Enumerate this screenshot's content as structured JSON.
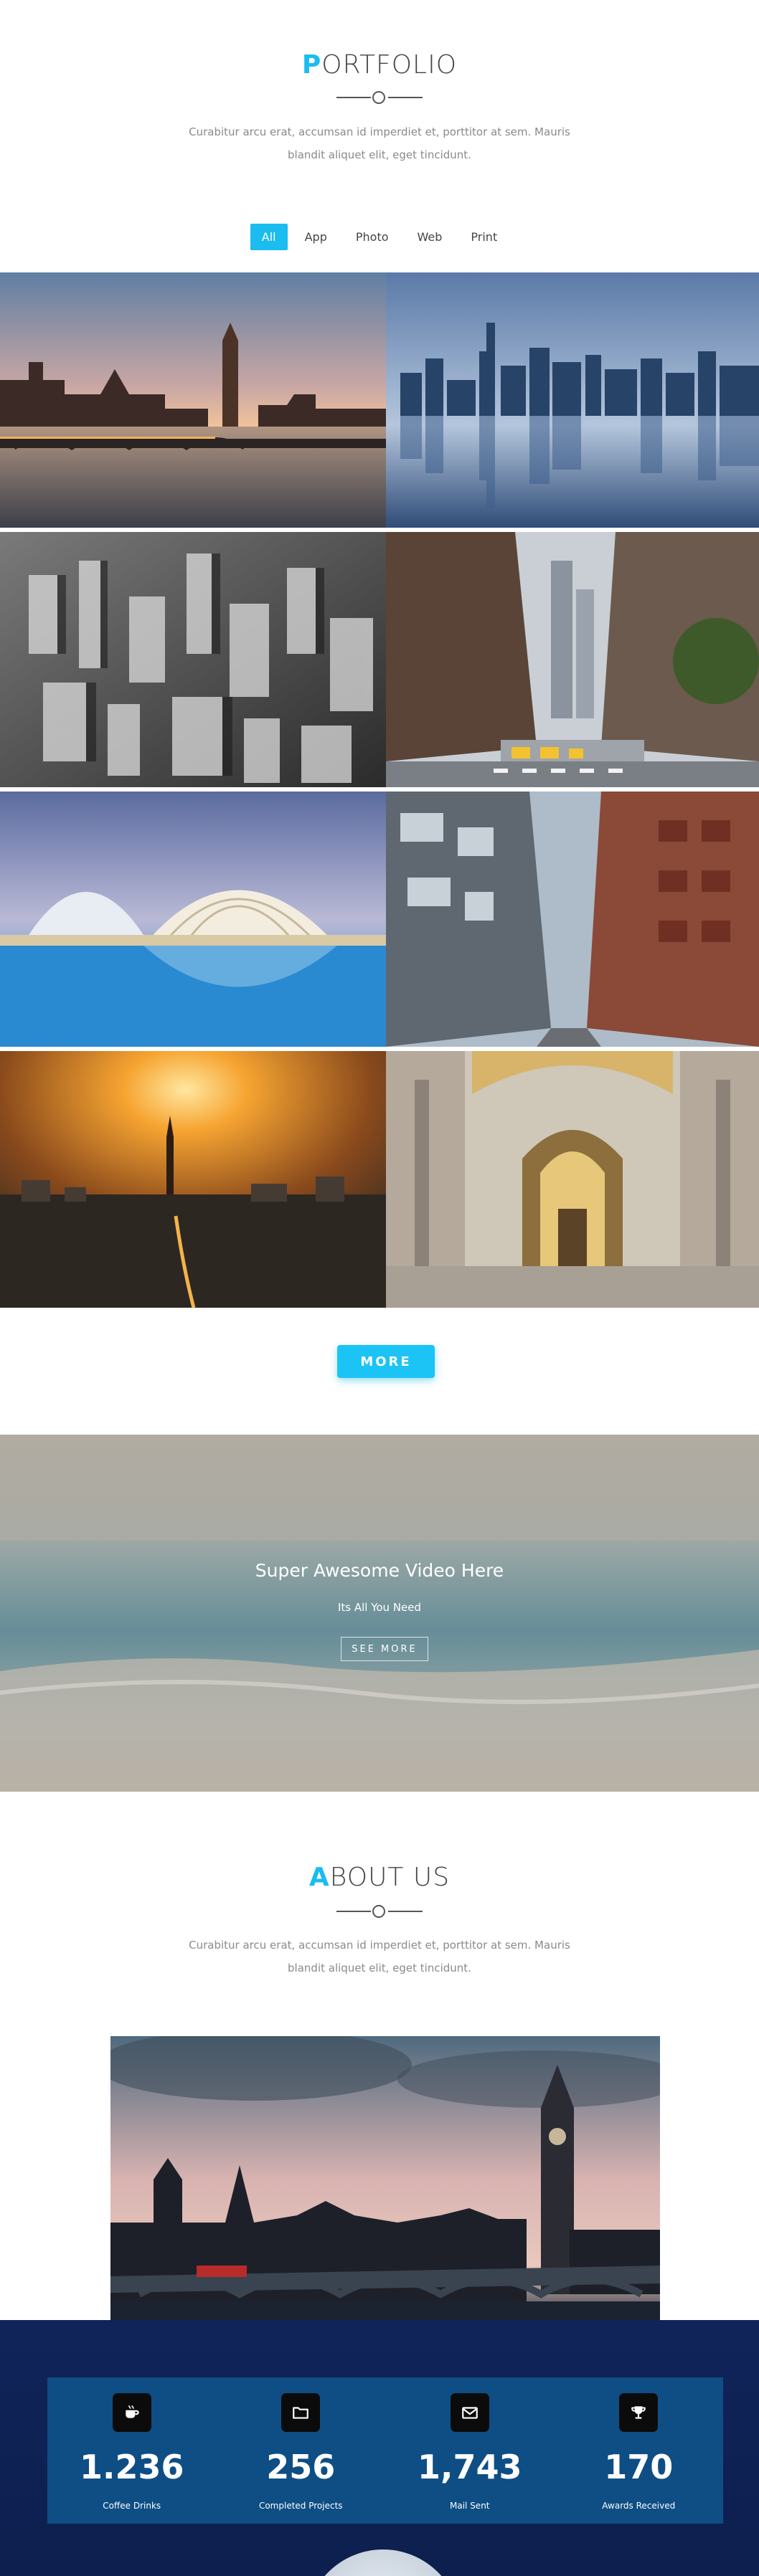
{
  "portfolio": {
    "title_first": "P",
    "title_rest": "ORTFOLIO",
    "description": "Curabitur arcu erat, accumsan id imperdiet et, porttitor at sem. Mauris blandit aliquet elit, eget tincidunt.",
    "filters": [
      "All",
      "App",
      "Photo",
      "Web",
      "Print"
    ],
    "active_filter": "All",
    "items": [
      {
        "name": "london-bridge-sunset"
      },
      {
        "name": "city-skyline-reflection"
      },
      {
        "name": "bw-aerial-city"
      },
      {
        "name": "city-street-crosswalk"
      },
      {
        "name": "futuristic-architecture"
      },
      {
        "name": "city-avenue"
      },
      {
        "name": "sunset-city-tower"
      },
      {
        "name": "cathedral-interior"
      }
    ],
    "more_label": "MORE"
  },
  "video": {
    "title": "Super Awesome Video Here",
    "subtitle": "Its All You Need",
    "button_label": "SEE MORE"
  },
  "about": {
    "title_first": "A",
    "title_rest": "BOUT US",
    "description": "Curabitur arcu erat, accumsan id imperdiet et, porttitor at sem. Mauris blandit aliquet elit, eget tincidunt."
  },
  "stats": [
    {
      "icon": "coffee-icon",
      "value": "1.236",
      "label": "Coffee Drinks"
    },
    {
      "icon": "folder-icon",
      "value": "256",
      "label": "Completed Projects"
    },
    {
      "icon": "envelope-icon",
      "value": "1,743",
      "label": "Mail Sent"
    },
    {
      "icon": "trophy-icon",
      "value": "170",
      "label": "Awards Received"
    }
  ],
  "colors": {
    "accent": "#1bbcef",
    "stats_background": "#10245a",
    "stats_box": "#0e4e84"
  }
}
